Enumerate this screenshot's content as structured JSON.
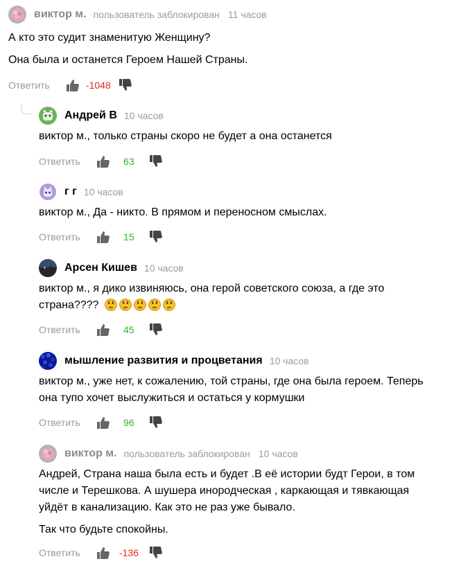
{
  "ui": {
    "reply_label": "Ответить"
  },
  "comments": [
    {
      "author": "виктор м.",
      "blocked_label": "пользователь заблокирован",
      "time": "11 часов",
      "text": [
        "А кто это судит знаменитую Женщину?",
        "Она была и останется Героем Нашей Страны."
      ],
      "votes": "-1048",
      "avatar": "pink-flower"
    },
    {
      "author": "Андрей В",
      "time": "10 часов",
      "text": [
        "виктор м., только страны скоро не будет а она останется"
      ],
      "votes": "63",
      "avatar": "green-face"
    },
    {
      "author": "г г",
      "time": "10 часов",
      "text": [
        "виктор м., Да - никто. В прямом и переносном смыслах."
      ],
      "votes": "15",
      "avatar": "purple-face"
    },
    {
      "author": "Арсен Кишев",
      "time": "10 часов",
      "text_line1": "виктор м., я дико извиняюсь, она герой советского союза, а где это",
      "text_line2": "страна????",
      "emoji_count": 5,
      "votes": "45",
      "avatar": "mountain-photo"
    },
    {
      "author": "мышление развития и процветания",
      "time": "10 часов",
      "text": [
        "виктор м., уже нет, к сожалению, той страны, где она была героем. Теперь",
        "она тупо хочет выслужиться и остаться у кормушки"
      ],
      "votes": "96",
      "avatar": "blue-flowers"
    },
    {
      "author": "виктор м.",
      "blocked_label": "пользователь заблокирован",
      "time": "10 часов",
      "text": [
        "Андрей, Страна наша была есть и будет .В её истории будт Герои, в том",
        "числе и Терешкова. А шушера инородческая , каркающая и тявкающая",
        "уйдёт в канализацию. Как это не раз уже бывало."
      ],
      "text_extra": "Так что будьте спокойны.",
      "votes": "-136",
      "avatar": "pink-flower"
    }
  ],
  "colors": {
    "positive": "#2ab72a",
    "negative": "#e8261b",
    "muted": "#9a9a9a"
  }
}
